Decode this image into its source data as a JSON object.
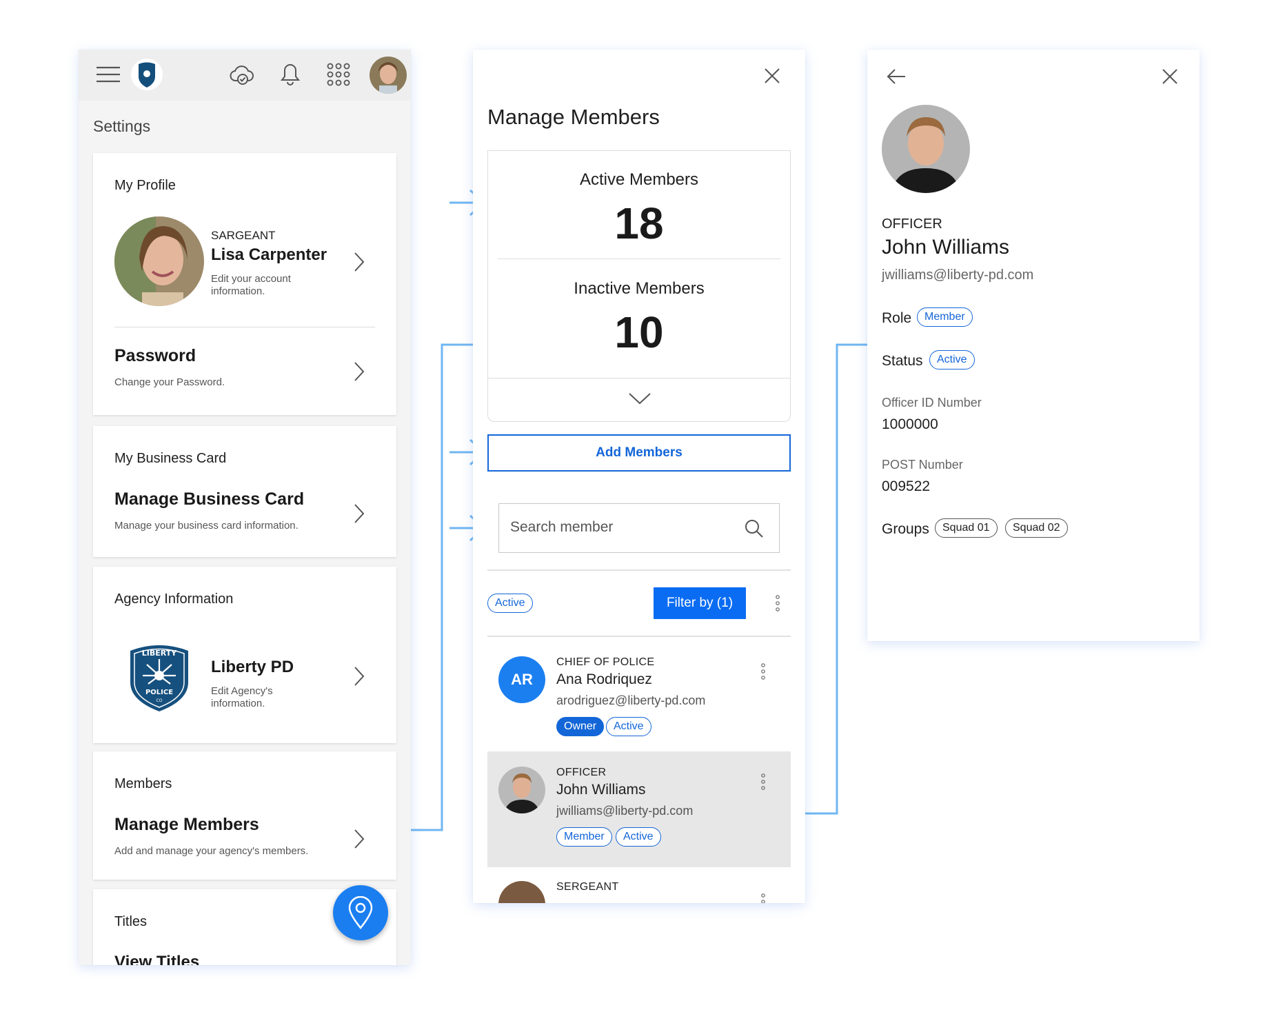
{
  "settings": {
    "title": "Settings",
    "my_profile": {
      "section": "My Profile",
      "rank": "SARGEANT",
      "name": "Lisa Carpenter",
      "desc": "Edit your account information."
    },
    "password": {
      "title": "Password",
      "desc": "Change your Password."
    },
    "business_card": {
      "section": "My Business Card",
      "title": "Manage Business Card",
      "desc": "Manage your business card information."
    },
    "agency": {
      "section": "Agency Information",
      "name": "Liberty PD",
      "desc": "Edit Agency's information.",
      "badge_top": "LIBERTY",
      "badge_bottom": "POLICE",
      "badge_co": "CO"
    },
    "members": {
      "section": "Members",
      "title": "Manage Members",
      "desc": "Add and manage your agency's members."
    },
    "titles": {
      "section": "Titles",
      "title": "View Titles"
    }
  },
  "manage": {
    "title": "Manage Members",
    "active_label": "Active Members",
    "active_count": "18",
    "inactive_label": "Inactive Members",
    "inactive_count": "10",
    "add_button": "Add Members",
    "search_placeholder": "Search member",
    "active_filter": "Active",
    "filter_button": "Filter by (1)",
    "members": [
      {
        "initials": "AR",
        "role": "CHIEF OF POLICE",
        "name": "Ana Rodriquez",
        "email": "arodriguez@liberty-pd.com",
        "tags": [
          "Owner",
          "Active"
        ]
      },
      {
        "role": "OFFICER",
        "name": "John Williams",
        "email": "jwilliams@liberty-pd.com",
        "tags": [
          "Member",
          "Active"
        ]
      },
      {
        "role": "SERGEANT"
      }
    ]
  },
  "detail": {
    "rank": "OFFICER",
    "name": "John Williams",
    "email": "jwilliams@liberty-pd.com",
    "role_label": "Role",
    "role_value": "Member",
    "status_label": "Status",
    "status_value": "Active",
    "officer_id_label": "Officer ID Number",
    "officer_id": "1000000",
    "post_label": "POST Number",
    "post_number": "009522",
    "groups_label": "Groups",
    "groups": [
      "Squad 01",
      "Squad 02"
    ]
  },
  "colors": {
    "accent": "#1366d8",
    "connector": "#6fb6f2",
    "fab": "#1a7ef0"
  }
}
